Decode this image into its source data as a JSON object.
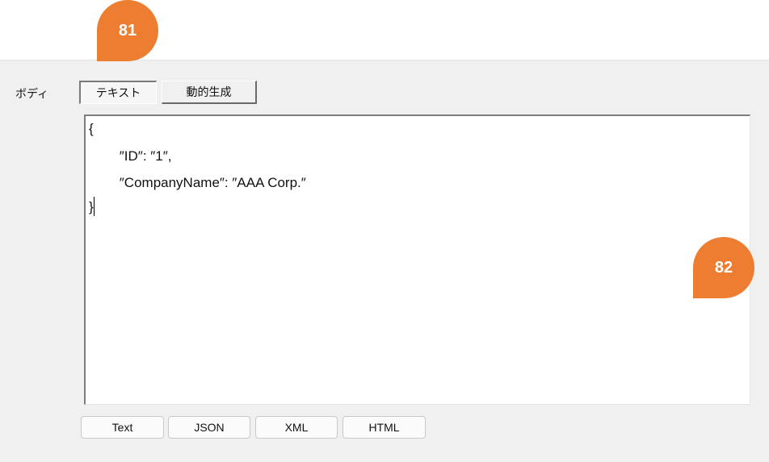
{
  "body_label": "ボディ",
  "tabs": [
    {
      "label": "テキスト",
      "active": true
    },
    {
      "label": "動的生成",
      "active": false
    }
  ],
  "editor": {
    "lines": [
      "{",
      "        ″ID″: ″1″,",
      "        ″CompanyName″: ″AAA Corp.″",
      "}"
    ]
  },
  "format_buttons": [
    "Text",
    "JSON",
    "XML",
    "HTML"
  ],
  "callouts": {
    "tabs": "81",
    "editor": "82"
  },
  "colors": {
    "callout": "#ed7d31",
    "panel": "#f0f0f0"
  }
}
